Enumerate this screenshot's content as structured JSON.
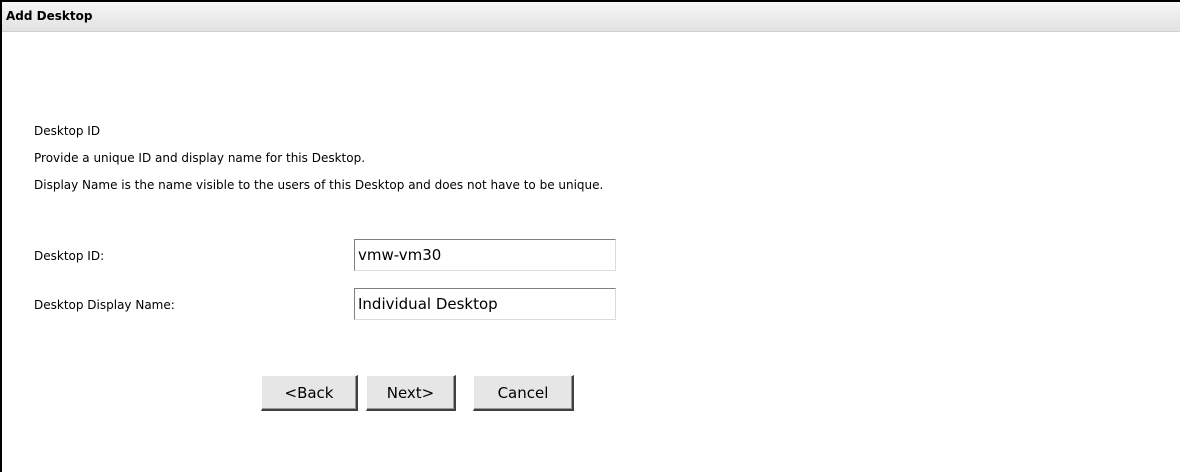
{
  "dialog": {
    "title": "Add Desktop"
  },
  "description": {
    "heading": "Desktop ID",
    "line1": "Provide a unique ID and display name for this Desktop.",
    "line2": "Display Name is the name visible to the users of this Desktop and does not have to be unique."
  },
  "form": {
    "desktop_id": {
      "label": "Desktop ID:",
      "value": "vmw-vm30"
    },
    "display_name": {
      "label": "Desktop Display Name:",
      "value": "Individual Desktop"
    }
  },
  "buttons": {
    "back": "<Back",
    "next": "Next>",
    "cancel": "Cancel"
  },
  "colors": {
    "title_bar": "#e6e6e6",
    "button_face": "#e6e6e6",
    "border": "#000000"
  }
}
